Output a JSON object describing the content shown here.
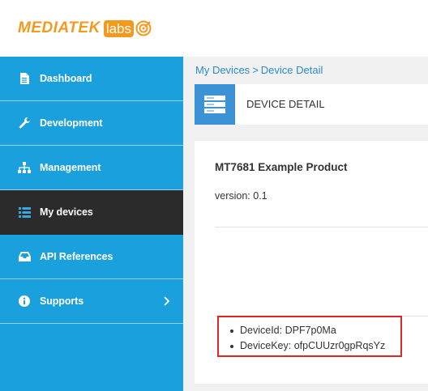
{
  "header": {
    "logo_text": "MEDIATEK",
    "logo_labs": "labs"
  },
  "sidebar": {
    "items": [
      {
        "label": "Dashboard",
        "icon": "file-icon",
        "active": false
      },
      {
        "label": "Development",
        "icon": "wrench-icon",
        "active": false
      },
      {
        "label": "Management",
        "icon": "sitemap-icon",
        "active": false
      },
      {
        "label": "My devices",
        "icon": "list-icon",
        "active": true
      },
      {
        "label": "API References",
        "icon": "inbox-icon",
        "active": false
      },
      {
        "label": "Supports",
        "icon": "info-icon",
        "active": false,
        "has_submenu": true
      }
    ]
  },
  "breadcrumb": {
    "parent": "My Devices",
    "separator": ">",
    "current": "Device Detail"
  },
  "page_title": "DEVICE DETAIL",
  "device": {
    "name": "MT7681 Example Product",
    "version": "version: 0.1",
    "device_id": "DeviceId: DPF7p0Ma",
    "device_key": "DeviceKey: ofpCUUzr0gpRqsYz"
  },
  "colors": {
    "sidebar": "#1aa0dd",
    "sidebar_active": "#2b2b2b",
    "brand_orange": "#f39a1e",
    "highlight_border": "#e0262c",
    "title_icon": "#3b93d6"
  }
}
